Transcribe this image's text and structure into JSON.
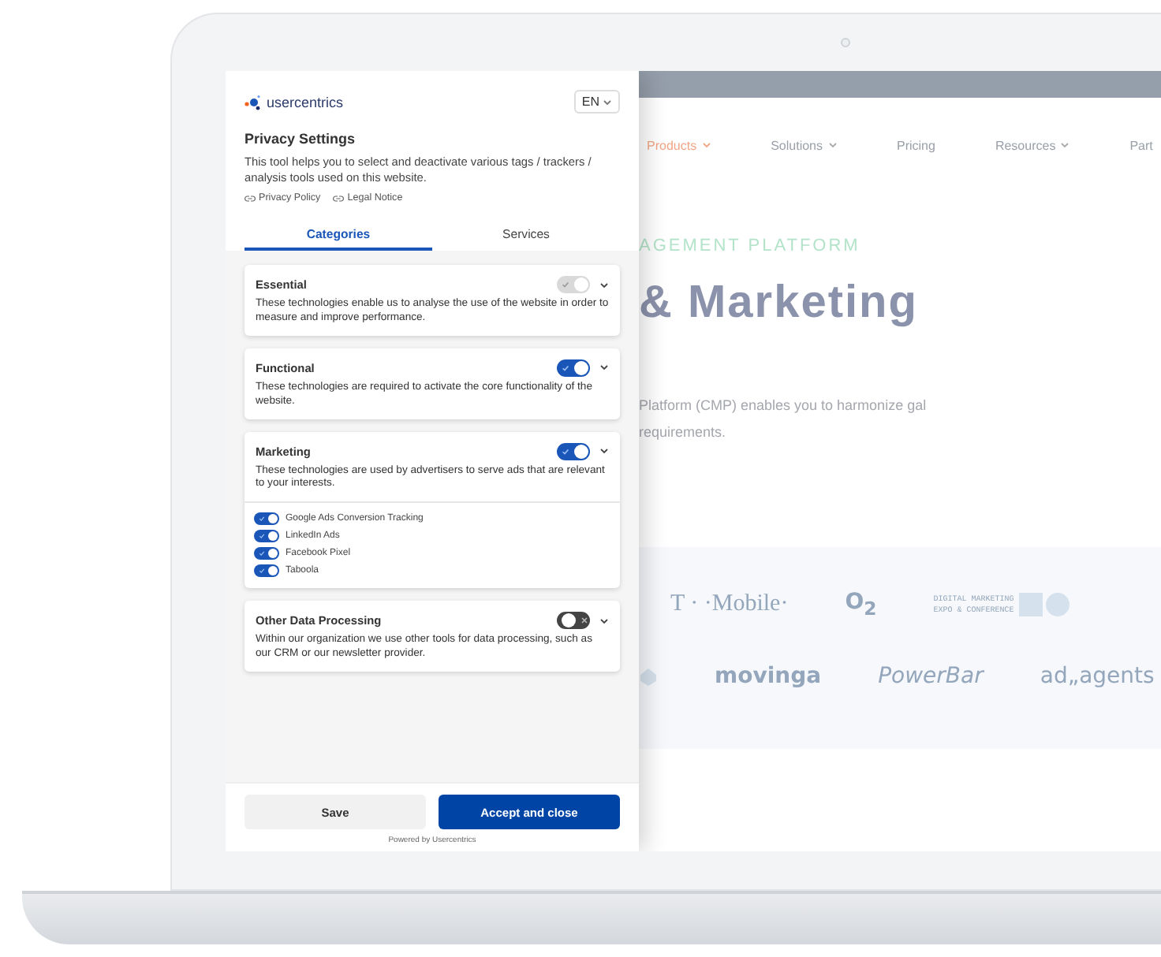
{
  "banner": {
    "brand": "usercentrics",
    "language": "EN",
    "title": "Privacy Settings",
    "description": "This tool helps you to select and deactivate various tags / trackers / analysis tools used on this website.",
    "links": [
      {
        "label": "Privacy Policy"
      },
      {
        "label": "Legal Notice"
      }
    ],
    "tabs": [
      {
        "label": "Categories",
        "selected": true
      },
      {
        "label": "Services",
        "selected": false
      }
    ],
    "categories": [
      {
        "name": "Essential",
        "description": "These technologies enable us to analyse the use of the website in order to measure and improve performance.",
        "on": true,
        "disabled": true
      },
      {
        "name": "Functional",
        "description": "These technologies are required to activate the core functionality of the website.",
        "on": true,
        "disabled": false
      },
      {
        "name": "Marketing",
        "description": "These technologies are used by advertisers to serve ads that are relevant to your interests.",
        "on": true,
        "disabled": false,
        "services": [
          {
            "name": "Google Ads Conversion Tracking",
            "on": true
          },
          {
            "name": "LinkedIn Ads",
            "on": true
          },
          {
            "name": "Facebook Pixel",
            "on": true
          },
          {
            "name": "Taboola",
            "on": true
          }
        ]
      },
      {
        "name": "Other Data Processing",
        "description": "Within our organization we use other tools for data processing, such as our CRM or our newsletter provider.",
        "on": false,
        "disabled": false
      }
    ],
    "buttons": [
      {
        "label": "Save",
        "kind": "secondary"
      },
      {
        "label": "Accept and close",
        "kind": "primary"
      }
    ],
    "powered_by": "Powered by Usercentrics"
  },
  "website": {
    "nav": [
      {
        "label": "Products",
        "selected": true,
        "dropdown": true
      },
      {
        "label": "Solutions",
        "selected": false,
        "dropdown": true
      },
      {
        "label": "Pricing",
        "selected": false,
        "dropdown": false
      },
      {
        "label": "Resources",
        "selected": false,
        "dropdown": true
      },
      {
        "label": "Part",
        "selected": false,
        "dropdown": false
      }
    ],
    "eyebrow": "AGEMENT PLATFORM",
    "headline": "& Marketing",
    "lead": "Platform (CMP) enables you to harmonize gal requirements.",
    "logo_rows": [
      [
        {
          "kind": "serif",
          "text": "T · ·Mobile·"
        },
        {
          "kind": "sans",
          "text": "O$_{2}$"
        },
        {
          "kind": "mono",
          "lines": [
            "DIGITAL MARKETING",
            "EXPO & CONFERENCE"
          ]
        }
      ],
      [
        {
          "kind": "shape"
        },
        {
          "kind": "sans",
          "text": "movinga"
        },
        {
          "kind": "italic",
          "text": "PowerBar"
        },
        {
          "kind": "light",
          "text": "ad„agents"
        }
      ]
    ]
  }
}
